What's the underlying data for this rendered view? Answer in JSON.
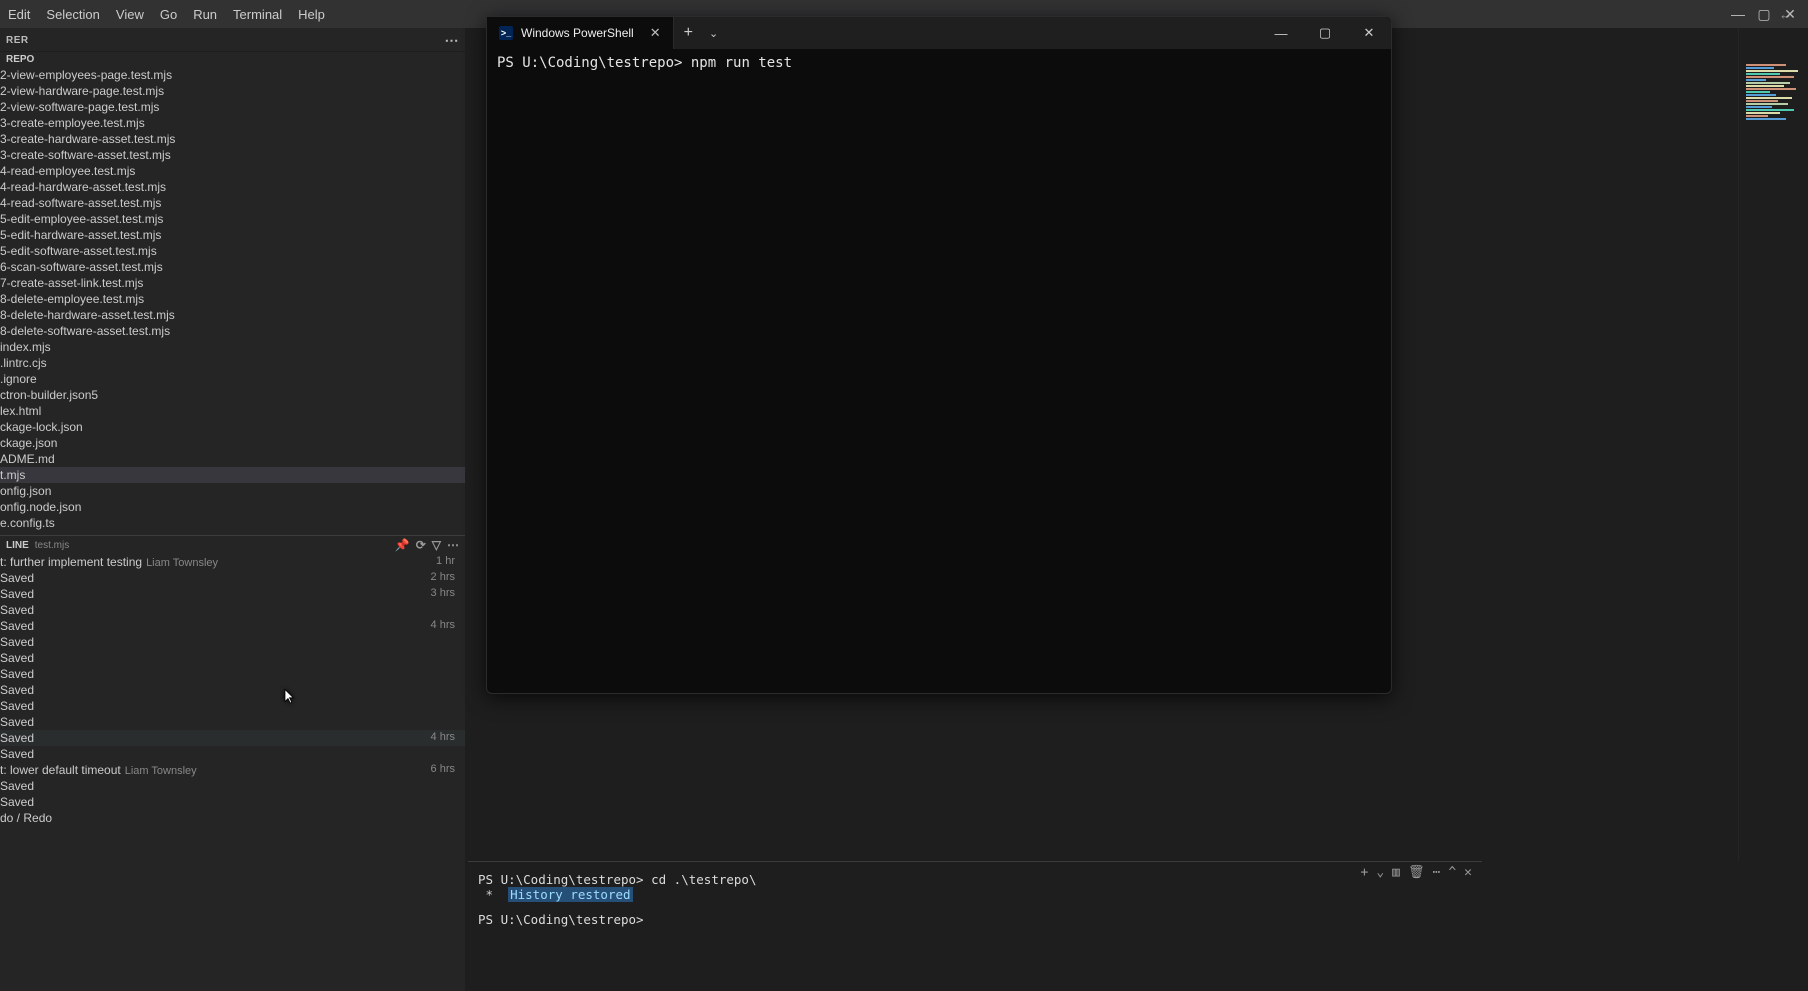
{
  "menubar": {
    "items": [
      "Edit",
      "Selection",
      "View",
      "Go",
      "Run",
      "Terminal",
      "Help"
    ]
  },
  "explorer": {
    "label": "RER",
    "folder_label": "REPO",
    "files": [
      "2-view-employees-page.test.mjs",
      "2-view-hardware-page.test.mjs",
      "2-view-software-page.test.mjs",
      "3-create-employee.test.mjs",
      "3-create-hardware-asset.test.mjs",
      "3-create-software-asset.test.mjs",
      "4-read-employee.test.mjs",
      "4-read-hardware-asset.test.mjs",
      "4-read-software-asset.test.mjs",
      "5-edit-employee-asset.test.mjs",
      "5-edit-hardware-asset.test.mjs",
      "5-edit-software-asset.test.mjs",
      "6-scan-software-asset.test.mjs",
      "7-create-asset-link.test.mjs",
      "8-delete-employee.test.mjs",
      "8-delete-hardware-asset.test.mjs",
      "8-delete-software-asset.test.mjs",
      "index.mjs",
      ".lintrc.cjs",
      ".ignore",
      "ctron-builder.json5",
      "lex.html",
      "ckage-lock.json",
      "ckage.json",
      "ADME.md",
      "t.mjs",
      "onfig.json",
      "onfig.node.json",
      "e.config.ts"
    ],
    "selected_index": 25
  },
  "timeline": {
    "label": "LINE",
    "file": "test.mjs",
    "entries": [
      {
        "msg": "t: further implement testing",
        "author": "Liam Townsley",
        "time": "1 hr"
      },
      {
        "msg": "Saved",
        "time": "2 hrs"
      },
      {
        "msg": "Saved",
        "time": "3 hrs"
      },
      {
        "msg": "Saved",
        "time": ""
      },
      {
        "msg": "Saved",
        "time": "4 hrs"
      },
      {
        "msg": "Saved",
        "time": ""
      },
      {
        "msg": "Saved",
        "time": ""
      },
      {
        "msg": "Saved",
        "time": ""
      },
      {
        "msg": "Saved",
        "time": ""
      },
      {
        "msg": "Saved",
        "time": ""
      },
      {
        "msg": "Saved",
        "time": ""
      },
      {
        "msg": "Saved",
        "time": "4 hrs"
      },
      {
        "msg": "Saved",
        "time": ""
      },
      {
        "msg": "t: lower default timeout",
        "author": "Liam Townsley",
        "time": "6 hrs"
      },
      {
        "msg": "Saved",
        "time": ""
      },
      {
        "msg": "Saved",
        "time": ""
      },
      {
        "msg": "do / Redo",
        "time": ""
      }
    ],
    "hover_index": 11
  },
  "integrated_terminal": {
    "lines": {
      "l1_prompt": "PS U:\\Coding\\testrepo>",
      "l1_cmd": "cd .\\testrepo\\",
      "l2_bullet": " *  ",
      "l2_hist": "History restored",
      "l3_prompt": "PS U:\\Coding\\testrepo>"
    }
  },
  "powershell": {
    "tab_title": "Windows PowerShell",
    "prompt": "PS U:\\Coding\\testrepo>",
    "command": "npm run test"
  }
}
